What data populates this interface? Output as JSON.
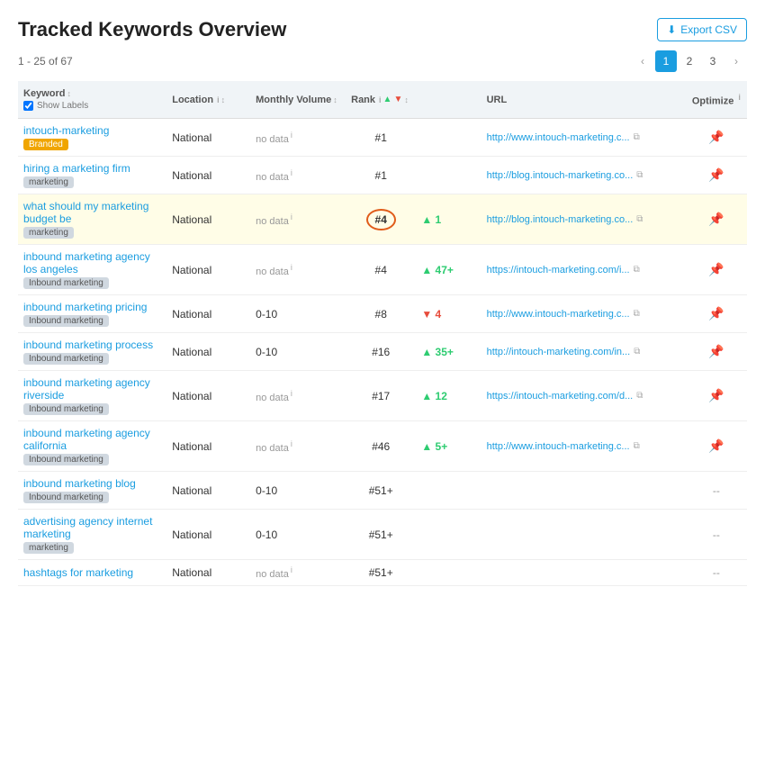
{
  "page": {
    "title": "Tracked Keywords Overview",
    "export_label": "Export CSV",
    "record_info": "1 - 25 of 67"
  },
  "pagination": {
    "prev_label": "‹",
    "next_label": "›",
    "pages": [
      "1",
      "2",
      "3"
    ]
  },
  "table": {
    "headers": {
      "keyword": "Keyword",
      "keyword_sub": "Show Labels",
      "location": "Location",
      "volume": "Monthly Volume",
      "rank": "Rank",
      "url": "URL",
      "optimize": "Optimize"
    },
    "rows": [
      {
        "keyword": "intouch-marketing",
        "tag": "Branded",
        "tag_class": "tag-branded",
        "location": "National",
        "volume": "no data",
        "rank": "#1",
        "rank_highlighted": false,
        "change_dir": "",
        "change_val": "",
        "url": "http://www.intouch-marketing.c...",
        "has_url": true
      },
      {
        "keyword": "hiring a marketing firm",
        "tag": "marketing",
        "tag_class": "tag-marketing",
        "location": "National",
        "volume": "no data",
        "rank": "#1",
        "rank_highlighted": false,
        "change_dir": "",
        "change_val": "",
        "url": "http://blog.intouch-marketing.co...",
        "has_url": true
      },
      {
        "keyword": "what should my marketing budget be",
        "tag": "marketing",
        "tag_class": "tag-marketing",
        "location": "National",
        "volume": "no data",
        "rank": "#4",
        "rank_highlighted": true,
        "change_dir": "up",
        "change_val": "1",
        "url": "http://blog.intouch-marketing.co...",
        "has_url": true
      },
      {
        "keyword": "inbound marketing agency los angeles",
        "tag": "Inbound marketing",
        "tag_class": "tag-inbound",
        "location": "National",
        "volume": "no data",
        "rank": "#4",
        "rank_highlighted": false,
        "change_dir": "up",
        "change_val": "47+",
        "url": "https://intouch-marketing.com/i...",
        "has_url": true
      },
      {
        "keyword": "inbound marketing pricing",
        "tag": "Inbound marketing",
        "tag_class": "tag-inbound",
        "location": "National",
        "volume": "0-10",
        "rank": "#8",
        "rank_highlighted": false,
        "change_dir": "down",
        "change_val": "4",
        "url": "http://www.intouch-marketing.c...",
        "has_url": true
      },
      {
        "keyword": "inbound marketing process",
        "tag": "Inbound marketing",
        "tag_class": "tag-inbound",
        "location": "National",
        "volume": "0-10",
        "rank": "#16",
        "rank_highlighted": false,
        "change_dir": "up",
        "change_val": "35+",
        "url": "http://intouch-marketing.com/in...",
        "has_url": true
      },
      {
        "keyword": "inbound marketing agency riverside",
        "tag": "Inbound marketing",
        "tag_class": "tag-inbound",
        "location": "National",
        "volume": "no data",
        "rank": "#17",
        "rank_highlighted": false,
        "change_dir": "up",
        "change_val": "12",
        "url": "https://intouch-marketing.com/d...",
        "has_url": true
      },
      {
        "keyword": "inbound marketing agency california",
        "tag": "Inbound marketing",
        "tag_class": "tag-inbound",
        "location": "National",
        "volume": "no data",
        "rank": "#46",
        "rank_highlighted": false,
        "change_dir": "up",
        "change_val": "5+",
        "url": "http://www.intouch-marketing.c...",
        "has_url": true
      },
      {
        "keyword": "inbound marketing blog",
        "tag": "Inbound marketing",
        "tag_class": "tag-inbound",
        "location": "National",
        "volume": "0-10",
        "rank": "#51+",
        "rank_highlighted": false,
        "change_dir": "",
        "change_val": "",
        "url": "",
        "has_url": false
      },
      {
        "keyword": "advertising agency internet marketing",
        "tag": "marketing",
        "tag_class": "tag-marketing",
        "location": "National",
        "volume": "0-10",
        "rank": "#51+",
        "rank_highlighted": false,
        "change_dir": "",
        "change_val": "",
        "url": "",
        "has_url": false
      },
      {
        "keyword": "hashtags for marketing",
        "tag": "",
        "tag_class": "",
        "location": "National",
        "volume": "no data",
        "rank": "#51+",
        "rank_highlighted": false,
        "change_dir": "",
        "change_val": "",
        "url": "",
        "has_url": false
      }
    ]
  }
}
